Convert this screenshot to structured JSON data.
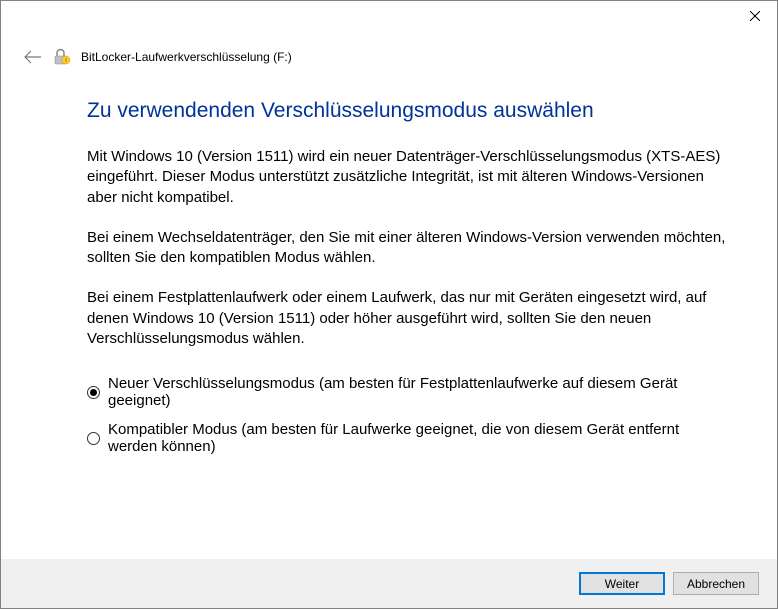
{
  "header": {
    "title": "BitLocker-Laufwerkverschlüsselung (F:)"
  },
  "content": {
    "heading": "Zu verwendenden Verschlüsselungsmodus auswählen",
    "para1": "Mit Windows 10 (Version 1511) wird ein neuer Datenträger-Verschlüsselungsmodus (XTS-AES) eingeführt. Dieser Modus unterstützt zusätzliche Integrität, ist mit älteren Windows-Versionen aber nicht kompatibel.",
    "para2": "Bei einem Wechseldatenträger, den Sie mit einer älteren Windows-Version verwenden möchten, sollten Sie den kompatiblen Modus wählen.",
    "para3": "Bei einem Festplattenlaufwerk oder einem Laufwerk, das nur mit Geräten eingesetzt wird, auf denen Windows 10 (Version 1511) oder höher ausgeführt wird, sollten Sie den neuen Verschlüsselungsmodus wählen."
  },
  "options": {
    "opt1": {
      "label": "Neuer Verschlüsselungsmodus (am besten für Festplattenlaufwerke auf diesem Gerät geeignet)",
      "checked": true
    },
    "opt2": {
      "label": "Kompatibler Modus (am besten für Laufwerke geeignet, die von diesem Gerät entfernt werden können)",
      "checked": false
    }
  },
  "footer": {
    "next": "Weiter",
    "cancel": "Abbrechen"
  }
}
